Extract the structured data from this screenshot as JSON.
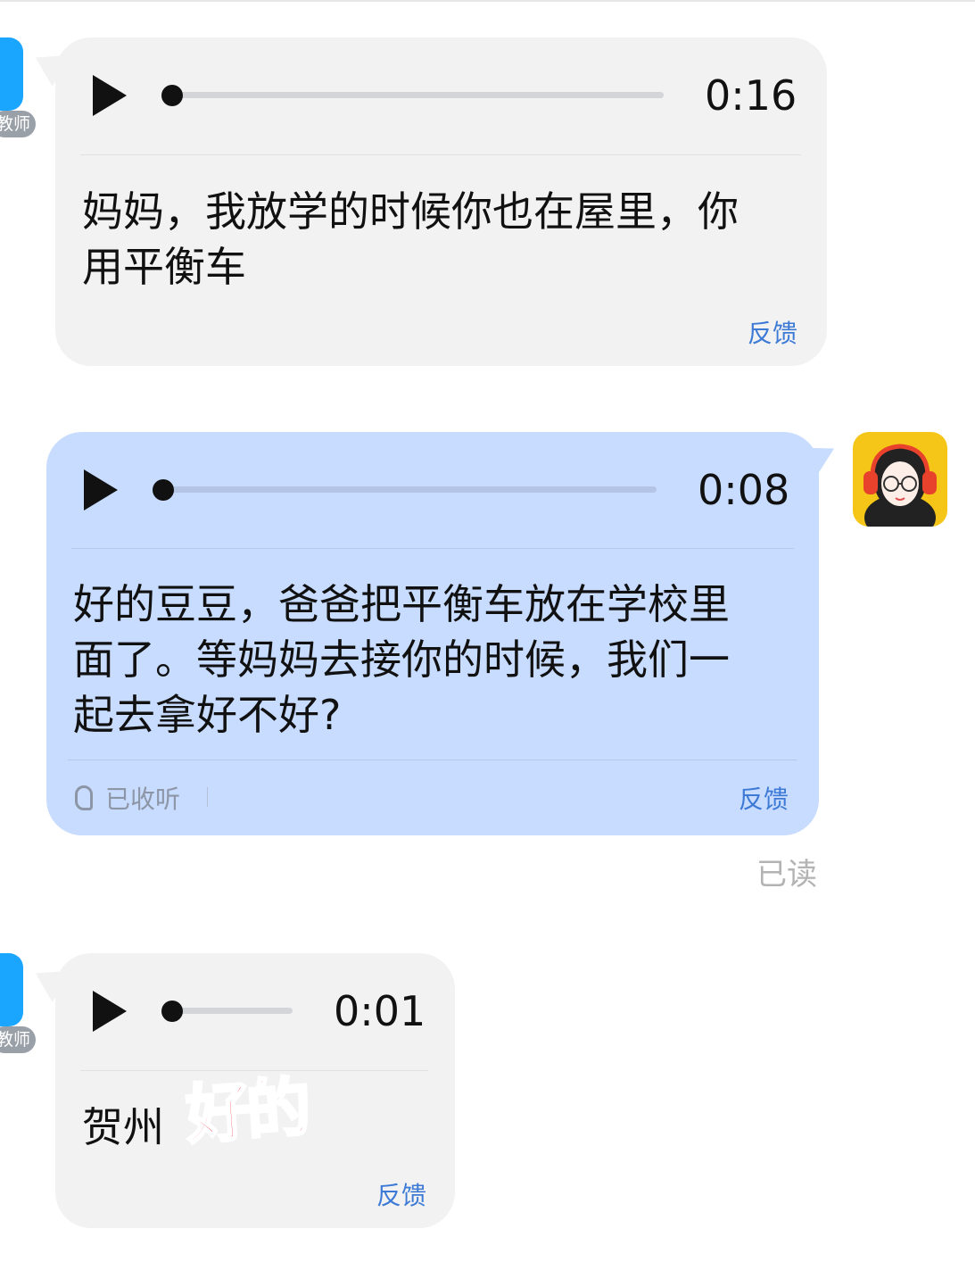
{
  "messages": [
    {
      "sender_tag": "教师",
      "duration": "0:16",
      "text": "妈妈，我放学的时候你也在屋里，你用平衡车",
      "feedback": "反馈"
    },
    {
      "duration": "0:08",
      "text": "好的豆豆，爸爸把平衡车放在学校里面了。等妈妈去接你的时候，我们一起去拿好不好?",
      "heard": "已收听",
      "feedback": "反馈",
      "read_status": "已读"
    },
    {
      "sender_tag": "教师",
      "duration": "0:01",
      "text": "贺州",
      "sticker": "好的",
      "feedback": "反馈"
    }
  ],
  "colors": {
    "incoming_bubble": "#f2f2f2",
    "outgoing_bubble": "#c8dcff",
    "feedback": "#3d7ad6",
    "teacher_avatar": "#1aa5ff"
  },
  "icons": [
    "play-icon",
    "ear-icon"
  ]
}
